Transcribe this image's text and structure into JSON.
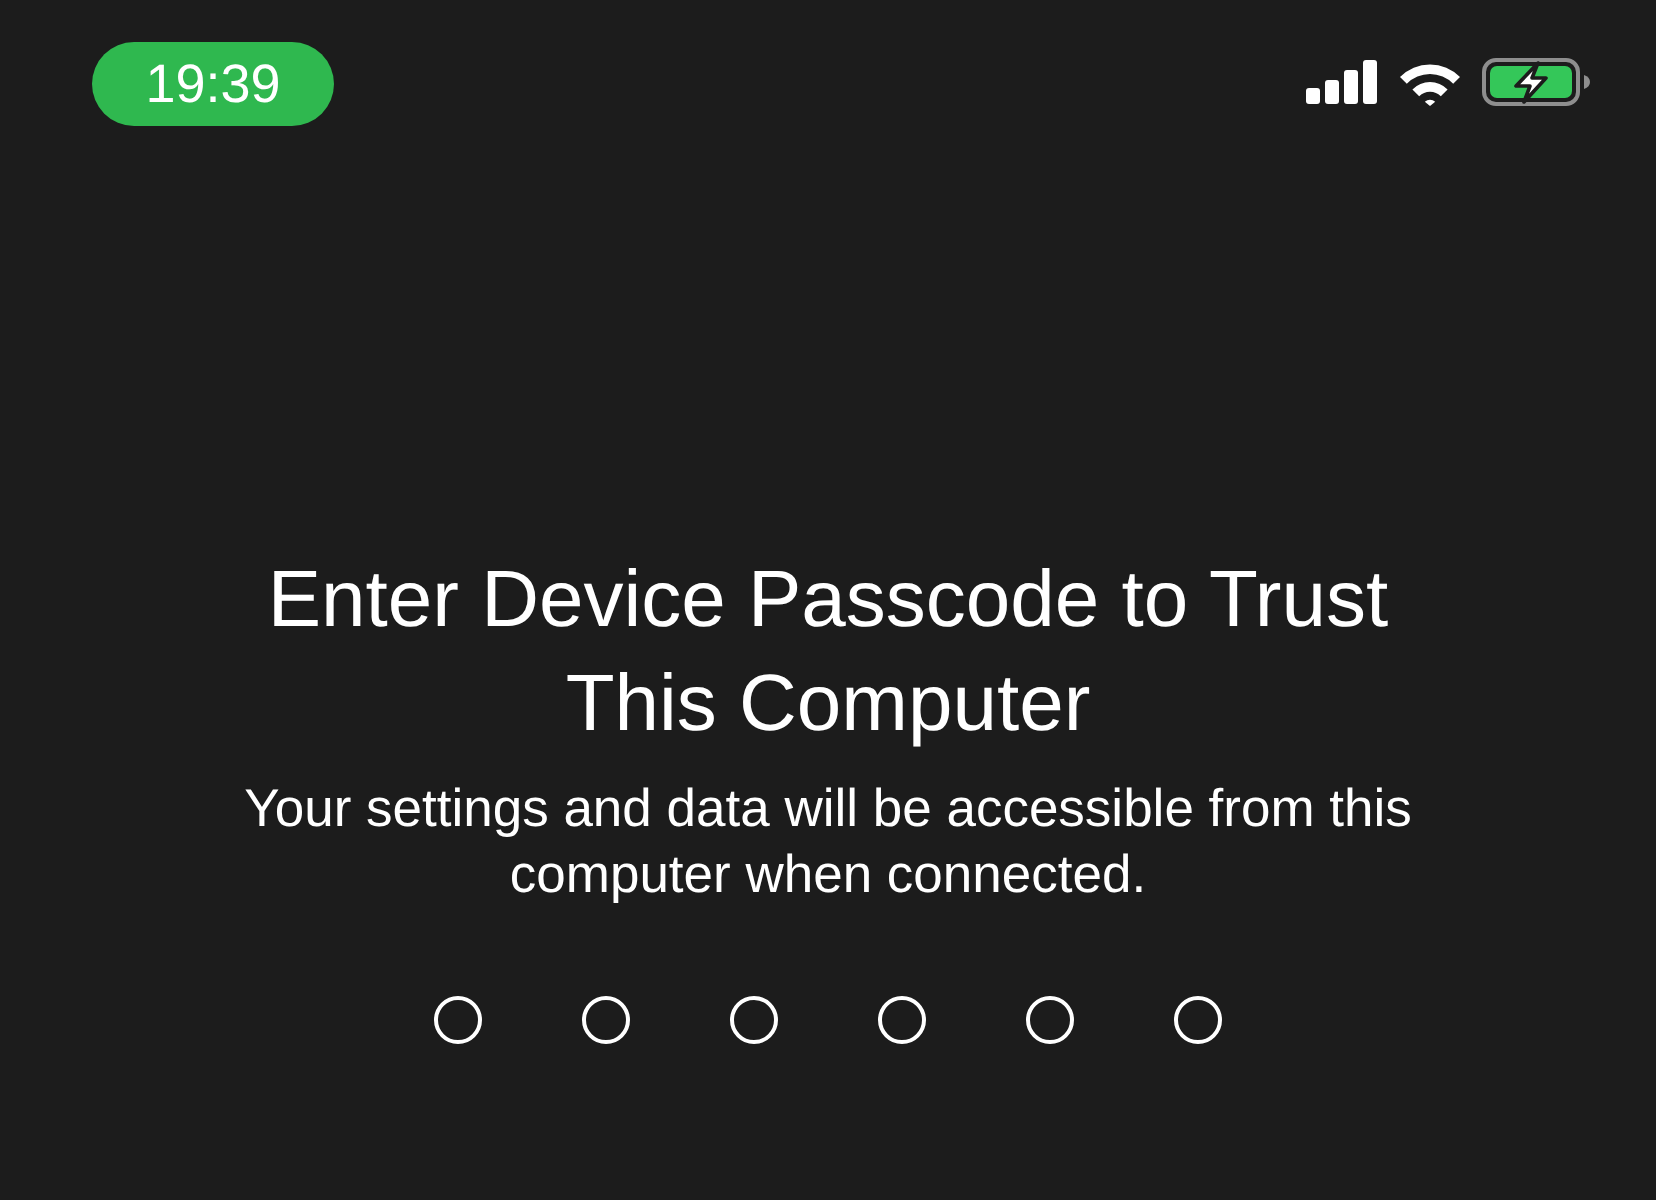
{
  "status_bar": {
    "time": "19:39",
    "charging": true
  },
  "prompt": {
    "title": "Enter Device Passcode to Trust This Computer",
    "message": "Your settings and data will be accessible from this computer when connected."
  },
  "passcode": {
    "digits": [
      {
        "filled": false
      },
      {
        "filled": false
      },
      {
        "filled": false
      },
      {
        "filled": false
      },
      {
        "filled": false
      },
      {
        "filled": false
      }
    ]
  }
}
